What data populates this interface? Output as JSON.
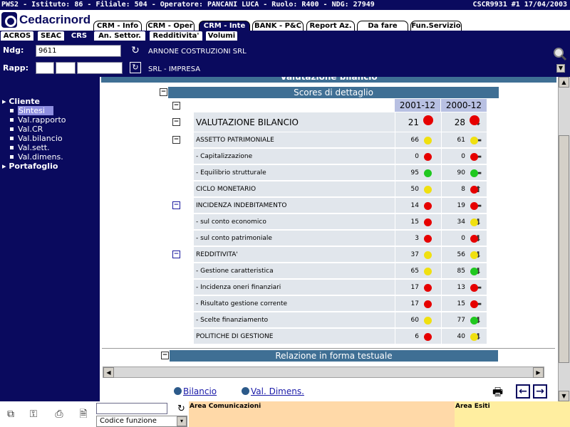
{
  "topbar": {
    "info": "PWS2 - Istituto: 86 - Filiale: 504 - Operatore: PANCANI LUCA - Ruolo: R400 - NDG: 27949",
    "code_date": "CSCR9931 #1      17/04/2003"
  },
  "brand": {
    "logo_text": "Cedacrinord"
  },
  "tabs_row1": [
    {
      "label": "CRM - Info",
      "active": false
    },
    {
      "label": "CRM - Oper",
      "active": false
    },
    {
      "label": "CRM - Inte",
      "active": true
    },
    {
      "label": "BANK - P&C",
      "active": false
    },
    {
      "label": "Report Az.",
      "active": false
    },
    {
      "label": "Da fare",
      "active": false
    },
    {
      "label": "Fun.Servizio",
      "active": false
    }
  ],
  "tabs_row2": [
    {
      "label": "ACROS",
      "active": false
    },
    {
      "label": "SEAC",
      "active": false
    },
    {
      "label": "CRS",
      "active": true
    },
    {
      "label": "An. Settor.",
      "active": false
    },
    {
      "label": "Redditivita'",
      "active": false
    },
    {
      "label": "Volumi",
      "active": false
    }
  ],
  "fields": {
    "ndg_label": "Ndg:",
    "ndg_value": "9611",
    "ndg_name": "ARNONE COSTRUZIONI SRL",
    "rapp_label": "Rapp:",
    "rapp_name": "SRL - IMPRESA"
  },
  "sidebar": {
    "cliente": "Cliente",
    "items": [
      {
        "label": "Sintesi",
        "selected": true
      },
      {
        "label": "Val.rapporto",
        "selected": false
      },
      {
        "label": "Val.CR",
        "selected": false
      },
      {
        "label": "Val.bilancio",
        "selected": false
      },
      {
        "label": "Val.sett.",
        "selected": false
      },
      {
        "label": "Val.dimens.",
        "selected": false
      }
    ],
    "portafoglio": "Portafoglio"
  },
  "content": {
    "cut_title": "Valutazione bilancio",
    "section_title": "Scores di dettaglio",
    "col1": "2001-12",
    "col2": "2000-12",
    "section2_title": "Relazione in forma testuale"
  },
  "colors": {
    "red": "#e60000",
    "yellow": "#f0e010",
    "green": "#20c820",
    "navy": "#0a0a5e"
  },
  "rows": [
    {
      "label": "VALUTAZIONE BILANCIO",
      "big": true,
      "arrow": "down",
      "v1": "21",
      "c1": "red",
      "v2": "28",
      "c2": "red",
      "toggle": "gray"
    },
    {
      "label": "ASSETTO PATRIMONIALE",
      "big": false,
      "arrow": "left",
      "v1": "66",
      "c1": "yellow",
      "v2": "61",
      "c2": "yellow",
      "toggle": "gray"
    },
    {
      "label": "- Capitalizzazione",
      "big": false,
      "arrow": "left",
      "v1": "0",
      "c1": "red",
      "v2": "0",
      "c2": "red",
      "toggle": ""
    },
    {
      "label": "- Equilibrio strutturale",
      "big": false,
      "arrow": "left",
      "v1": "95",
      "c1": "green",
      "v2": "90",
      "c2": "green",
      "toggle": ""
    },
    {
      "label": "CICLO MONETARIO",
      "big": false,
      "arrow": "up",
      "v1": "50",
      "c1": "yellow",
      "v2": "8",
      "c2": "red",
      "toggle": ""
    },
    {
      "label": "INCIDENZA INDEBITAMENTO",
      "big": false,
      "arrow": "left",
      "v1": "14",
      "c1": "red",
      "v2": "19",
      "c2": "red",
      "toggle": "blue"
    },
    {
      "label": "- sul conto economico",
      "big": false,
      "arrow": "down",
      "v1": "15",
      "c1": "red",
      "v2": "34",
      "c2": "yellow",
      "toggle": ""
    },
    {
      "label": "- sul conto patrimoniale",
      "big": false,
      "arrow": "down",
      "v1": "3",
      "c1": "red",
      "v2": "0",
      "c2": "red",
      "toggle": ""
    },
    {
      "label": "REDDITIVITA'",
      "big": false,
      "arrow": "down",
      "v1": "37",
      "c1": "yellow",
      "v2": "56",
      "c2": "yellow",
      "toggle": "blue"
    },
    {
      "label": "- Gestione caratteristica",
      "big": false,
      "arrow": "down",
      "v1": "65",
      "c1": "yellow",
      "v2": "85",
      "c2": "green",
      "toggle": ""
    },
    {
      "label": "- Incidenza oneri finanziari",
      "big": false,
      "arrow": "left",
      "v1": "17",
      "c1": "red",
      "v2": "13",
      "c2": "red",
      "toggle": ""
    },
    {
      "label": "- Risultato gestione corrente",
      "big": false,
      "arrow": "left",
      "v1": "17",
      "c1": "red",
      "v2": "15",
      "c2": "red",
      "toggle": ""
    },
    {
      "label": "- Scelte finanziamento",
      "big": false,
      "arrow": "down",
      "v1": "60",
      "c1": "yellow",
      "v2": "77",
      "c2": "green",
      "toggle": ""
    },
    {
      "label": "POLITICHE DI GESTIONE",
      "big": false,
      "arrow": "down",
      "v1": "6",
      "c1": "red",
      "v2": "40",
      "c2": "yellow",
      "toggle": ""
    }
  ],
  "links": {
    "bilancio": "Bilancio",
    "valdimens": "Val. Dimens."
  },
  "footer": {
    "codice_funzione": "Codice funzione",
    "area_comunicazioni": "Area Comunicazioni",
    "area_esiti": "Area Esiti"
  }
}
